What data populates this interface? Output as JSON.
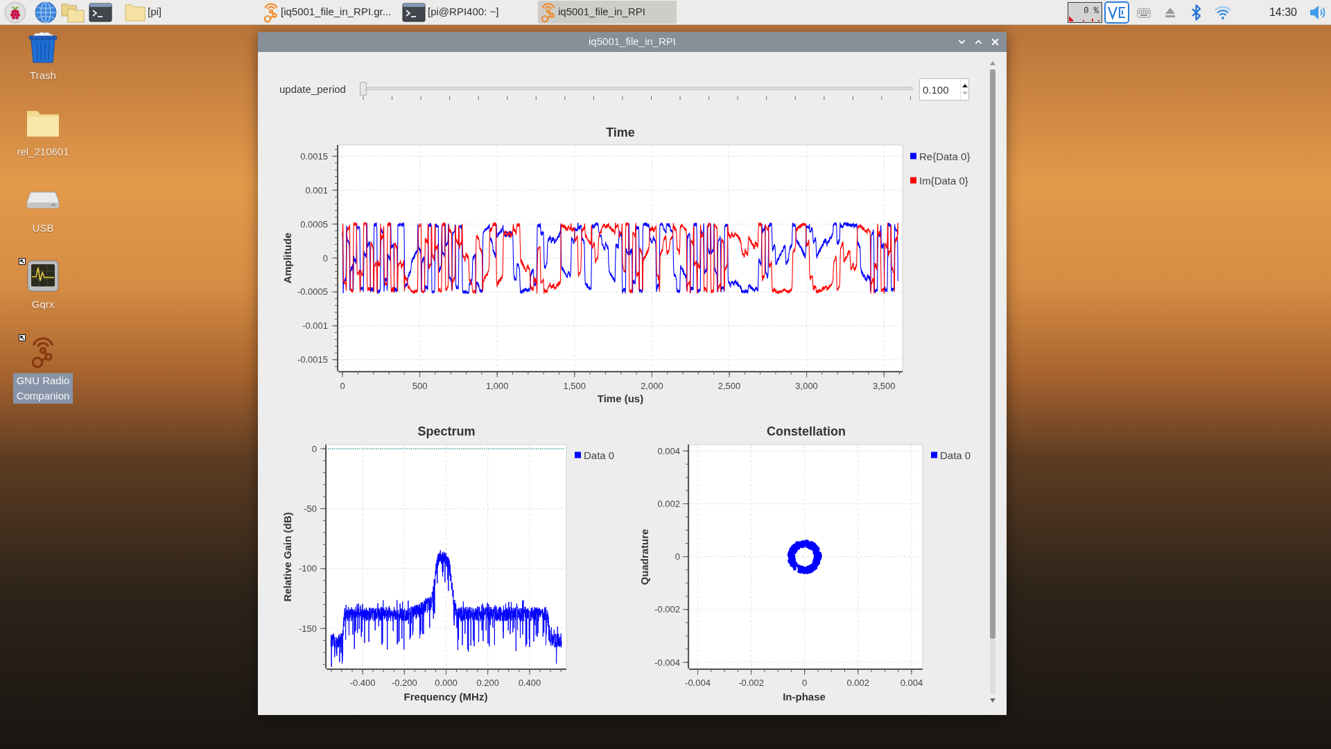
{
  "taskbar": {
    "tasks": [
      {
        "label": "[pi]",
        "selected": false
      },
      {
        "label": "[iq5001_file_in_RPI.gr...",
        "selected": false
      },
      {
        "label": "[pi@RPI400: ~]",
        "selected": false
      },
      {
        "label": "iq5001_file_in_RPI",
        "selected": true
      }
    ],
    "cpu_usage": "0 %",
    "clock": "14:30"
  },
  "desktop": {
    "icons": [
      {
        "label": "Trash",
        "shortcut": false,
        "selected": false
      },
      {
        "label": "rel_210601",
        "shortcut": false,
        "selected": false
      },
      {
        "label": "USB",
        "shortcut": false,
        "selected": false
      },
      {
        "label": "Gqrx",
        "shortcut": true,
        "selected": false
      },
      {
        "label": "GNU Radio Companion",
        "shortcut": true,
        "selected": true
      }
    ]
  },
  "window": {
    "title": "iq5001_file_in_RPI",
    "slider": {
      "label": "update_period",
      "level": 0
    },
    "spin_box": {
      "value": "0.100",
      "down_disabled": true
    },
    "time_plot": {
      "title": "Time",
      "ylabel": "Amplitude",
      "xlabel": "Time (us)",
      "yticks": [
        "0.0015",
        "0.001",
        "0.0005",
        "0",
        "-0.0005",
        "-0.001",
        "-0.0015"
      ],
      "xticks": [
        "0",
        "500",
        "1,000",
        "1,500",
        "2,000",
        "2,500",
        "3,000",
        "3,500"
      ],
      "legend": [
        {
          "label": "Re{Data 0}",
          "color": "#0000ff"
        },
        {
          "label": "Im{Data 0}",
          "color": "#ff0000"
        }
      ]
    },
    "spectrum_plot": {
      "title": "Spectrum",
      "ylabel": "Relative Gain (dB)",
      "xlabel": "Frequency (MHz)",
      "yticks": [
        "0",
        "-50",
        "-100",
        "-150"
      ],
      "xticks": [
        "-0.400",
        "-0.200",
        "0.000",
        "0.200",
        "0.400"
      ],
      "legend": [
        {
          "label": "Data 0",
          "color": "#0000ff"
        }
      ]
    },
    "constellation_plot": {
      "title": "Constellation",
      "ylabel": "Quadrature",
      "xlabel": "In-phase",
      "yticks": [
        "0.004",
        "0.002",
        "0",
        "-0.002",
        "-0.004"
      ],
      "xticks": [
        "-0.004",
        "-0.002",
        "0",
        "0.002",
        "0.004"
      ],
      "legend": [
        {
          "label": "Data 0",
          "color": "#0000ff"
        }
      ]
    }
  }
}
